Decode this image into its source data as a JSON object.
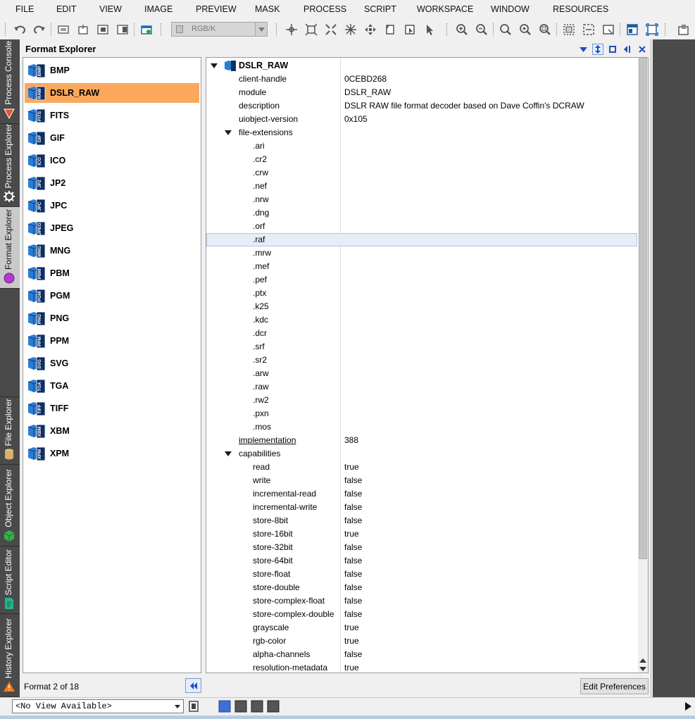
{
  "menu": [
    "FILE",
    "EDIT",
    "VIEW",
    "IMAGE",
    "PREVIEW",
    "MASK",
    "PROCESS",
    "SCRIPT",
    "WORKSPACE",
    "WINDOW",
    "RESOURCES"
  ],
  "toolbar": {
    "color_space_value": "RGB/K"
  },
  "side_tabs": [
    {
      "label": "Process Console",
      "icon": "process-console-icon"
    },
    {
      "label": "Process Explorer",
      "icon": "gear-icon"
    },
    {
      "label": "Format Explorer",
      "icon": "circle-icon"
    },
    {
      "label": "File Explorer",
      "icon": "cylinder-icon"
    },
    {
      "label": "Object Explorer",
      "icon": "cube-icon"
    },
    {
      "label": "Script Editor",
      "icon": "script-page-icon"
    },
    {
      "label": "History Explorer",
      "icon": "warning-triangle-icon"
    }
  ],
  "panel": {
    "title": "Format Explorer",
    "formats": [
      "BMP",
      "DSLR_RAW",
      "FITS",
      "GIF",
      "ICO",
      "JP2",
      "JPC",
      "JPEG",
      "MNG",
      "PBM",
      "PGM",
      "PNG",
      "PPM",
      "SVG",
      "TGA",
      "TIFF",
      "XBM",
      "XPM"
    ],
    "selected_format": "DSLR_RAW",
    "status": "Format 2 of 18",
    "edit_preferences_label": "Edit Preferences"
  },
  "tree": {
    "root": "DSLR_RAW",
    "properties": [
      {
        "name": "client-handle",
        "value": "0CEBD268"
      },
      {
        "name": "module",
        "value": "DSLR_RAW"
      },
      {
        "name": "description",
        "value": "DSLR RAW file format decoder based on Dave Coffin's DCRAW"
      },
      {
        "name": "uiobject-version",
        "value": "0x105"
      }
    ],
    "file_extensions_label": "file-extensions",
    "file_extensions": [
      ".ari",
      ".cr2",
      ".crw",
      ".nef",
      ".nrw",
      ".dng",
      ".orf",
      ".raf",
      ".mrw",
      ".mef",
      ".pef",
      ".ptx",
      ".k25",
      ".kdc",
      ".dcr",
      ".srf",
      ".sr2",
      ".arw",
      ".raw",
      ".rw2",
      ".pxn",
      ".mos"
    ],
    "implementation": {
      "name": "implementation",
      "value": "388"
    },
    "capabilities_label": "capabilities",
    "capabilities": [
      {
        "name": "read",
        "value": "true"
      },
      {
        "name": "write",
        "value": "false"
      },
      {
        "name": "incremental-read",
        "value": "false"
      },
      {
        "name": "incremental-write",
        "value": "false"
      },
      {
        "name": "store-8bit",
        "value": "false"
      },
      {
        "name": "store-16bit",
        "value": "true"
      },
      {
        "name": "store-32bit",
        "value": "false"
      },
      {
        "name": "store-64bit",
        "value": "false"
      },
      {
        "name": "store-float",
        "value": "false"
      },
      {
        "name": "store-double",
        "value": "false"
      },
      {
        "name": "store-complex-float",
        "value": "false"
      },
      {
        "name": "store-complex-double",
        "value": "false"
      },
      {
        "name": "grayscale",
        "value": "true"
      },
      {
        "name": "rgb-color",
        "value": "true"
      },
      {
        "name": "alpha-channels",
        "value": "false"
      },
      {
        "name": "resolution-metadata",
        "value": "true"
      }
    ]
  },
  "bottom_bar": {
    "view_select_value": "<No View Available>"
  }
}
